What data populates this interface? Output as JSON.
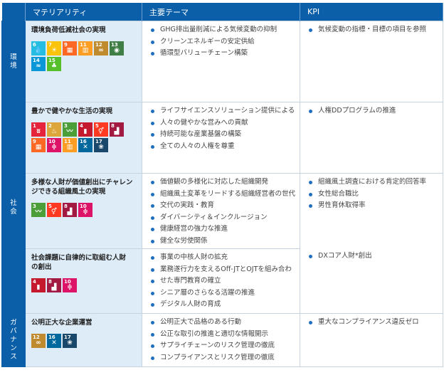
{
  "headers": {
    "materiality": "マテリアリティ",
    "theme": "主要テーマ",
    "kpi": "KPI"
  },
  "categories": {
    "env": [
      "環",
      "境"
    ],
    "soc": [
      "社",
      "会"
    ],
    "gov": [
      "ガ",
      "バ",
      "ナ",
      "ン",
      "ス"
    ]
  },
  "rows": [
    {
      "title": "環境負荷低減社会の実現",
      "sdgs": [
        {
          "n": "6",
          "color": "#26bde2",
          "icon": "water-drop-icon",
          "glyph": "💧"
        },
        {
          "n": "7",
          "color": "#fcc30b",
          "icon": "sun-icon",
          "glyph": "☀"
        },
        {
          "n": "9",
          "color": "#fd6925",
          "icon": "cubes-icon",
          "glyph": "▦"
        },
        {
          "n": "11",
          "color": "#fd9d24",
          "icon": "buildings-icon",
          "glyph": "▥"
        },
        {
          "n": "12",
          "color": "#bf8b2e",
          "icon": "infinity-icon",
          "glyph": "∞"
        },
        {
          "n": "13",
          "color": "#3f7e44",
          "icon": "eye-globe-icon",
          "glyph": "◉"
        },
        {
          "n": "14",
          "color": "#0a97d9",
          "icon": "fish-icon",
          "glyph": "≈"
        },
        {
          "n": "15",
          "color": "#56c02b",
          "icon": "tree-icon",
          "glyph": "♣"
        }
      ],
      "themes": [
        "GHG排出量削減による気候変動の抑制",
        "クリーンエネルギーの安定供給",
        "循環型バリューチェーン構築"
      ],
      "kpis": [
        "気候変動の指標・目標の項目を参照"
      ]
    },
    {
      "title": "豊かで健やかな生活の実現",
      "sdgs": [
        {
          "n": "1",
          "color": "#e5243b",
          "icon": "family-icon",
          "glyph": "ʬ"
        },
        {
          "n": "2",
          "color": "#dda63a",
          "icon": "bowl-icon",
          "glyph": "♨"
        },
        {
          "n": "3",
          "color": "#4c9f38",
          "icon": "heartbeat-icon",
          "glyph": "〰"
        },
        {
          "n": "4",
          "color": "#c5192d",
          "icon": "book-icon",
          "glyph": "▮"
        },
        {
          "n": "5",
          "color": "#ff3a21",
          "icon": "gender-icon",
          "glyph": "⚥"
        },
        {
          "n": "8",
          "color": "#a21942",
          "icon": "growth-chart-icon",
          "glyph": "▟"
        },
        {
          "n": "9",
          "color": "#fd6925",
          "icon": "cubes-icon",
          "glyph": "▦"
        },
        {
          "n": "10",
          "color": "#dd1367",
          "icon": "equal-icon",
          "glyph": "≑"
        },
        {
          "n": "11",
          "color": "#fd9d24",
          "icon": "buildings-icon",
          "glyph": "▥"
        },
        {
          "n": "16",
          "color": "#00689d",
          "icon": "dove-icon",
          "glyph": "✕"
        },
        {
          "n": "17",
          "color": "#19486a",
          "icon": "flower-icon",
          "glyph": "❀"
        }
      ],
      "themes": [
        "ライフサイエンスソリューション提供による",
        "人々の健やかな営みへの貢献",
        "持続可能な産業基盤の構築",
        "全ての人々の人権を尊重"
      ],
      "kpis": [
        "人権DDプログラムの推進"
      ]
    },
    {
      "title_lines": [
        "多様な人財が価値創出にチャレン",
        "ジできる組織風土の実現"
      ],
      "sdgs": [
        {
          "n": "3",
          "color": "#4c9f38",
          "icon": "heartbeat-icon",
          "glyph": "〰"
        },
        {
          "n": "5",
          "color": "#ff3a21",
          "icon": "gender-icon",
          "glyph": "⚥"
        },
        {
          "n": "8",
          "color": "#a21942",
          "icon": "growth-chart-icon",
          "glyph": "▟"
        },
        {
          "n": "10",
          "color": "#dd1367",
          "icon": "equal-icon",
          "glyph": "≑"
        }
      ],
      "themes": [
        "価値観の多様化に対応した組織開発",
        "組織風土変革をリードする組織経営者の世代",
        "交代の実践・教育",
        "ダイバーシティ＆インクルージョン",
        "健康経営の強力な推進",
        "健全な労使関係"
      ],
      "kpis": [
        "組織風土調査における肯定的回答率",
        "女性総合職比",
        "男性育休取得率"
      ]
    },
    {
      "title_lines": [
        "社会課題に自律的に取組む人財",
        "の創出"
      ],
      "sdgs": [
        {
          "n": "4",
          "color": "#c5192d",
          "icon": "book-icon",
          "glyph": "▮"
        },
        {
          "n": "8",
          "color": "#a21942",
          "icon": "growth-chart-icon",
          "glyph": "▟"
        },
        {
          "n": "10",
          "color": "#dd1367",
          "icon": "equal-icon",
          "glyph": "≑"
        }
      ],
      "themes": [
        "事業の中核人財の拡充",
        "業務遂行力を支えるOff-JTとOJTを組み合わ",
        "せた専門教育の確立",
        "シニア層のさらなる活躍の推進",
        "デジタル人財の育成"
      ],
      "kpis": [
        "DXコア人財*創出"
      ]
    },
    {
      "title": "公明正大な企業運営",
      "sdgs": [
        {
          "n": "12",
          "color": "#bf8b2e",
          "icon": "infinity-icon",
          "glyph": "∞"
        },
        {
          "n": "16",
          "color": "#00689d",
          "icon": "dove-icon",
          "glyph": "✕"
        },
        {
          "n": "17",
          "color": "#19486a",
          "icon": "flower-icon",
          "glyph": "❀"
        }
      ],
      "themes": [
        "公明正大で品格のある行動",
        "公正な取引の推進と適切な情報開示",
        "サプライチェーンのリスク管理の徹底",
        "コンプライアンスとリスク管理の徹底"
      ],
      "kpis": [
        "重大なコンプライアンス違反ゼロ"
      ]
    }
  ]
}
